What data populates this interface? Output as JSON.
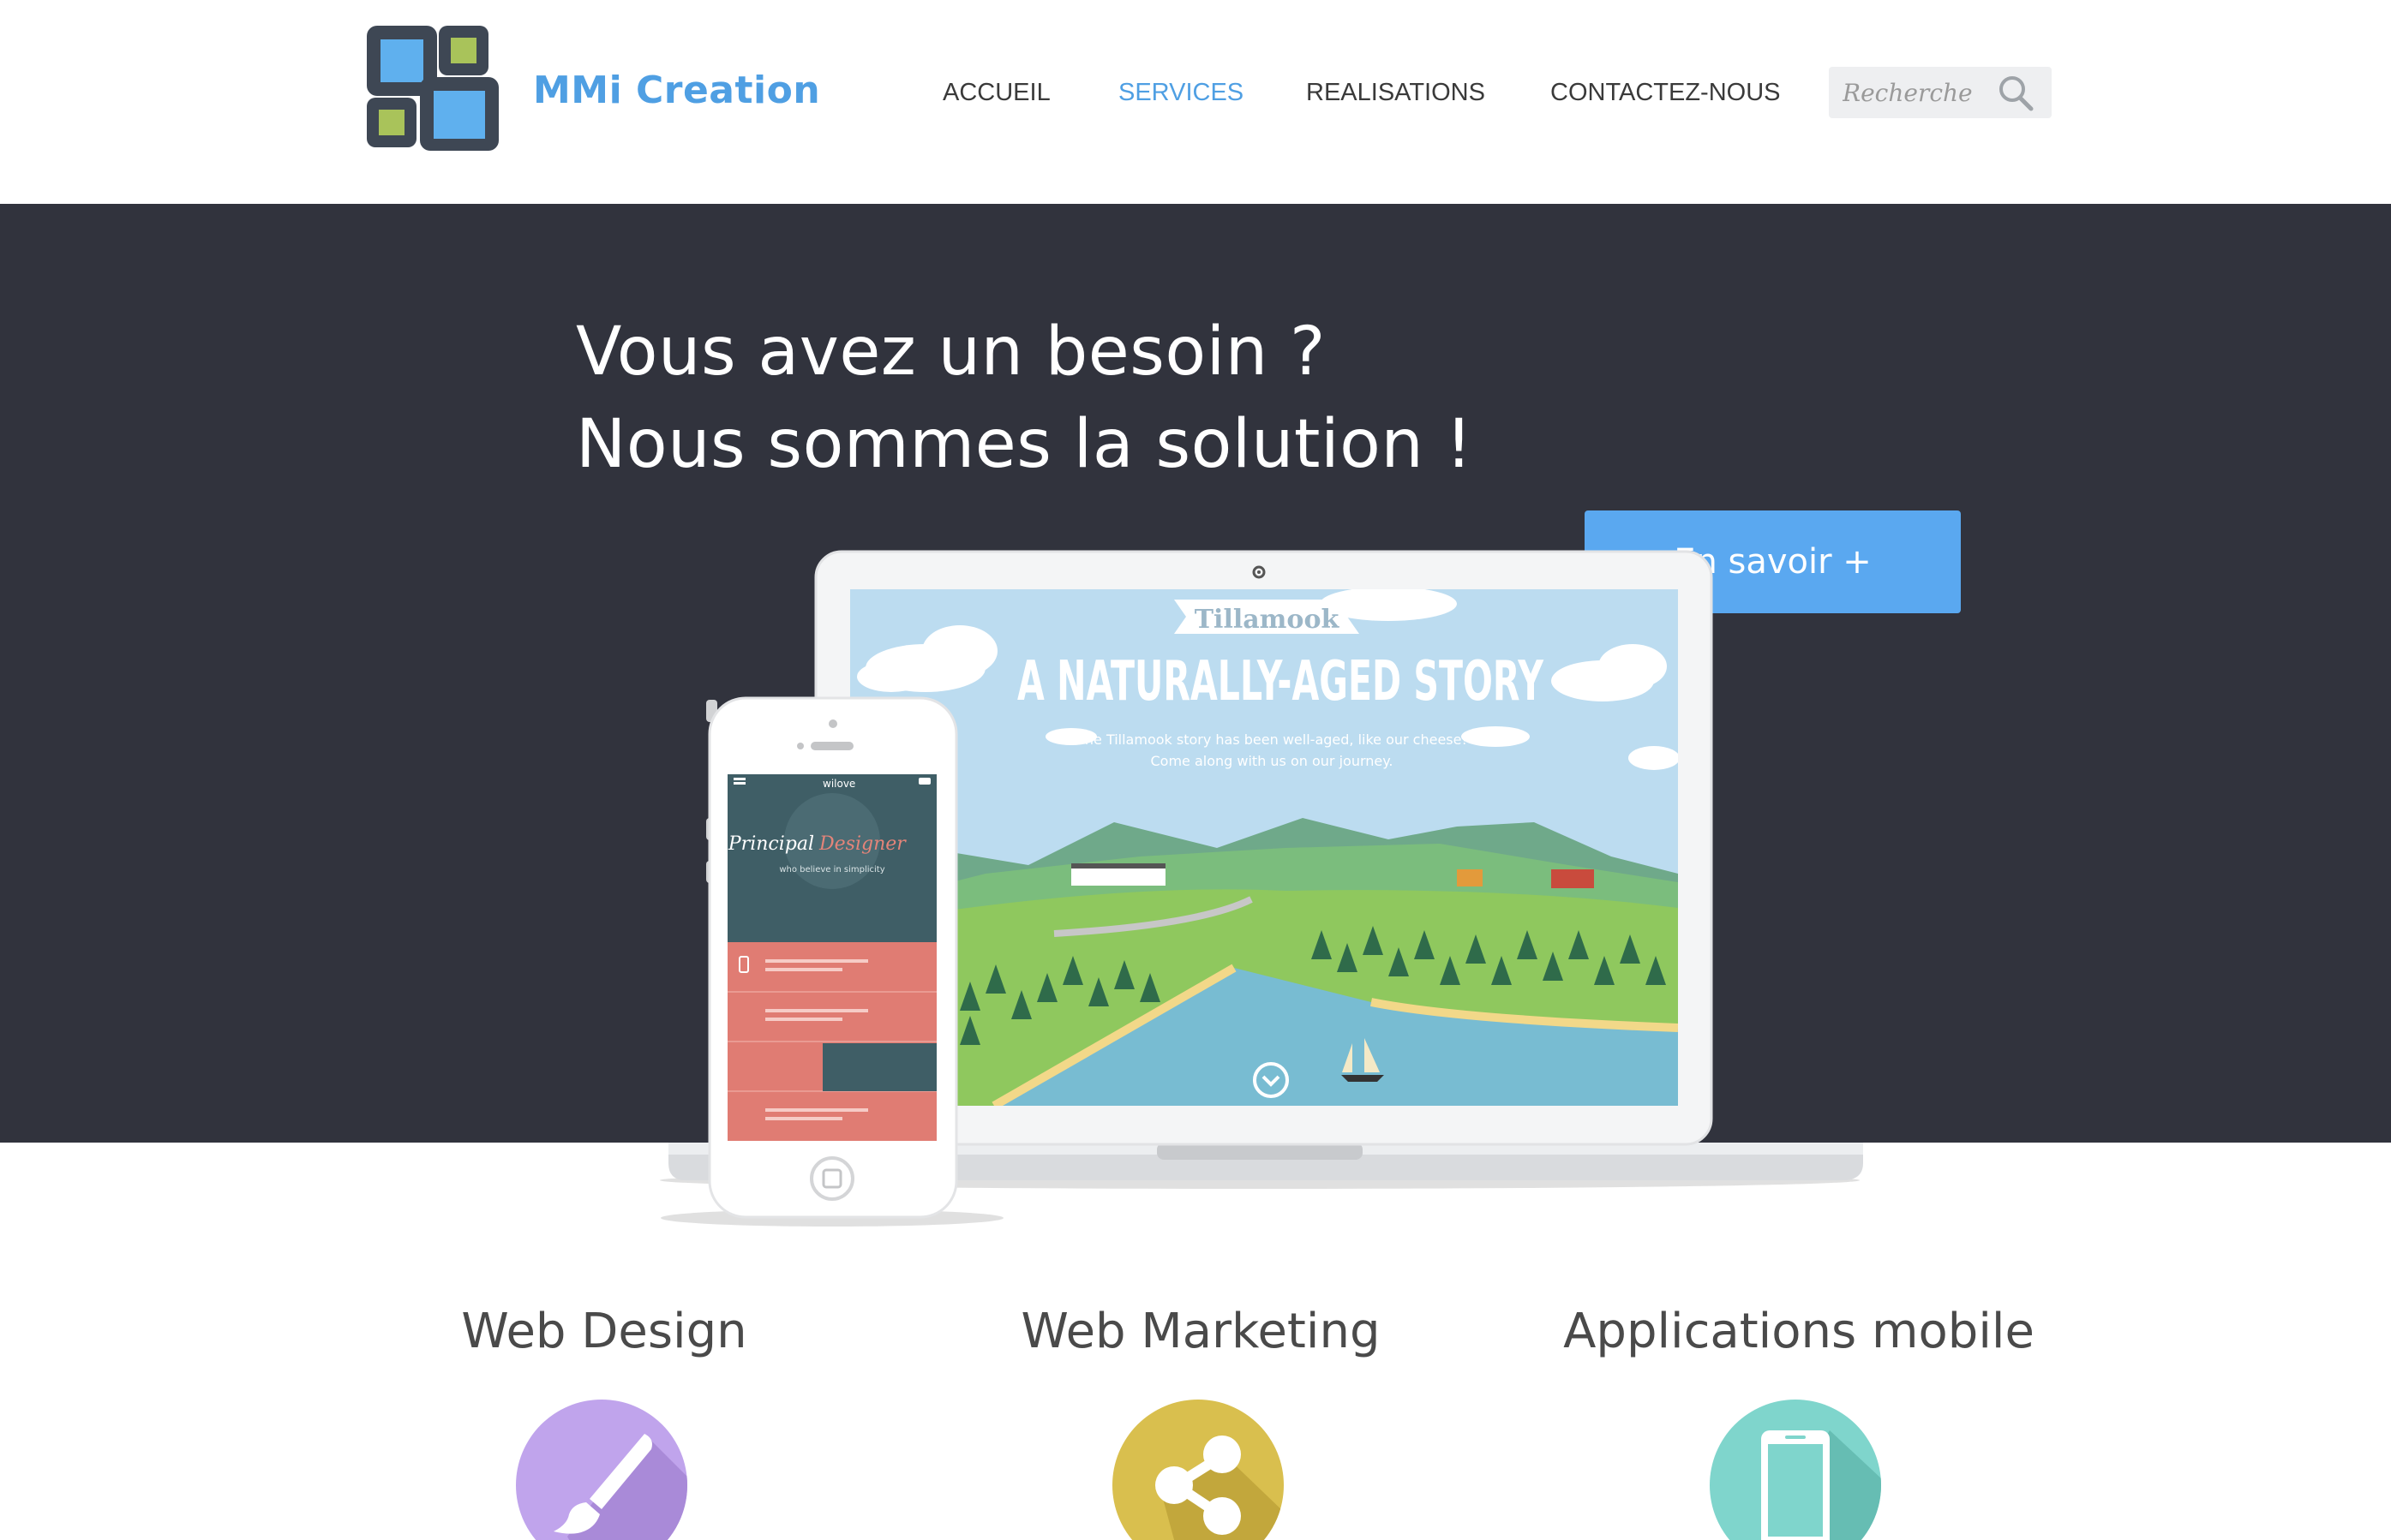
{
  "header": {
    "brand": "MMi Creation",
    "nav": [
      {
        "label": "ACCUEIL",
        "active": false
      },
      {
        "label": "SERVICES",
        "active": true
      },
      {
        "label": "REALISATIONS",
        "active": false
      },
      {
        "label": "CONTACTEZ-NOUS",
        "active": false
      }
    ],
    "search_placeholder": "Recherche"
  },
  "hero": {
    "line1": "Vous avez un besoin ?",
    "line2": "Nous sommes la solution !",
    "cta_label": "En savoir +"
  },
  "laptop_screen": {
    "banner": "Tillamook",
    "headline": "A NATURALLY-AGED STORY",
    "subtitle_line1": "The Tillamook story has been well-aged, like our cheese!",
    "subtitle_line2": "Come along with us on our journey."
  },
  "phone_screen": {
    "app_name": "wilove",
    "title_part1": "Principal",
    "title_part2": "Designer",
    "tagline": "who believe in simplicity"
  },
  "services": [
    {
      "title": "Web Design",
      "icon": "paintbrush-icon",
      "color": "#c0a4ec"
    },
    {
      "title": "Web Marketing",
      "icon": "share-icon",
      "color": "#d9bf4e"
    },
    {
      "title": "Applications mobile",
      "icon": "smartphone-icon",
      "color": "#7fd5cc"
    }
  ],
  "colors": {
    "accent": "#4f9fe3",
    "cta": "#5aa8f0",
    "hero_bg": "#31333d"
  }
}
